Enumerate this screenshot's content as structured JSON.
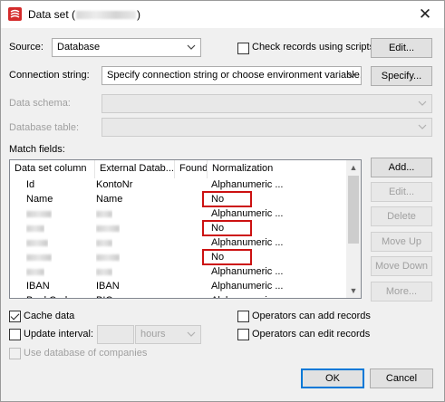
{
  "window": {
    "title_prefix": "Data set (",
    "title_suffix": ")",
    "close_glyph": "✕",
    "app_icon": "app-logo-icon",
    "accent_color": "#d42b2b"
  },
  "source": {
    "label": "Source:",
    "value": "Database",
    "check_records_label": "Check records using scripts",
    "check_records_checked": false,
    "edit_button": "Edit..."
  },
  "connection": {
    "label": "Connection string:",
    "value": "Specify connection string or choose environment variable.",
    "specify_button": "Specify..."
  },
  "data_schema": {
    "label": "Data schema:",
    "value": ""
  },
  "database_table": {
    "label": "Database table:",
    "value": ""
  },
  "match_fields": {
    "label": "Match fields:",
    "columns": [
      "Data set column",
      "External Datab...",
      "Found",
      "Normalization"
    ],
    "rows": [
      {
        "col": "Id",
        "ext": "KontoNr",
        "found": "",
        "norm": "Alphanumeric ...",
        "redacted": false,
        "highlight": false
      },
      {
        "col": "Name",
        "ext": "Name",
        "found": "",
        "norm": "No",
        "redacted": false,
        "highlight": true
      },
      {
        "col": "",
        "ext": "",
        "found": "",
        "norm": "Alphanumeric ...",
        "redacted": true,
        "highlight": false
      },
      {
        "col": "",
        "ext": "",
        "found": "",
        "norm": "No",
        "redacted": true,
        "highlight": true
      },
      {
        "col": "",
        "ext": "",
        "found": "",
        "norm": "Alphanumeric ...",
        "redacted": true,
        "highlight": false
      },
      {
        "col": "",
        "ext": "",
        "found": "",
        "norm": "No",
        "redacted": true,
        "highlight": true
      },
      {
        "col": "",
        "ext": "",
        "found": "",
        "norm": "Alphanumeric ...",
        "redacted": true,
        "highlight": false
      },
      {
        "col": "IBAN",
        "ext": "IBAN",
        "found": "",
        "norm": "Alphanumeric ...",
        "redacted": false,
        "highlight": false
      },
      {
        "col": "BankCode",
        "ext": "BIC",
        "found": "",
        "norm": "Alphanumeric ...",
        "redacted": false,
        "highlight": false
      }
    ],
    "buttons": {
      "add": "Add...",
      "edit": "Edit...",
      "delete": "Delete",
      "move_up": "Move Up",
      "move_down": "Move Down",
      "more": "More..."
    }
  },
  "options": {
    "cache_data": "Cache data",
    "cache_data_checked": true,
    "update_interval": "Update interval:",
    "update_interval_checked": false,
    "interval_value": "",
    "interval_unit": "hours",
    "use_database_of_companies": "Use database of companies",
    "operators_add": "Operators can add records",
    "operators_add_checked": false,
    "operators_edit": "Operators can edit records",
    "operators_edit_checked": false
  },
  "footer": {
    "ok": "OK",
    "cancel": "Cancel"
  }
}
